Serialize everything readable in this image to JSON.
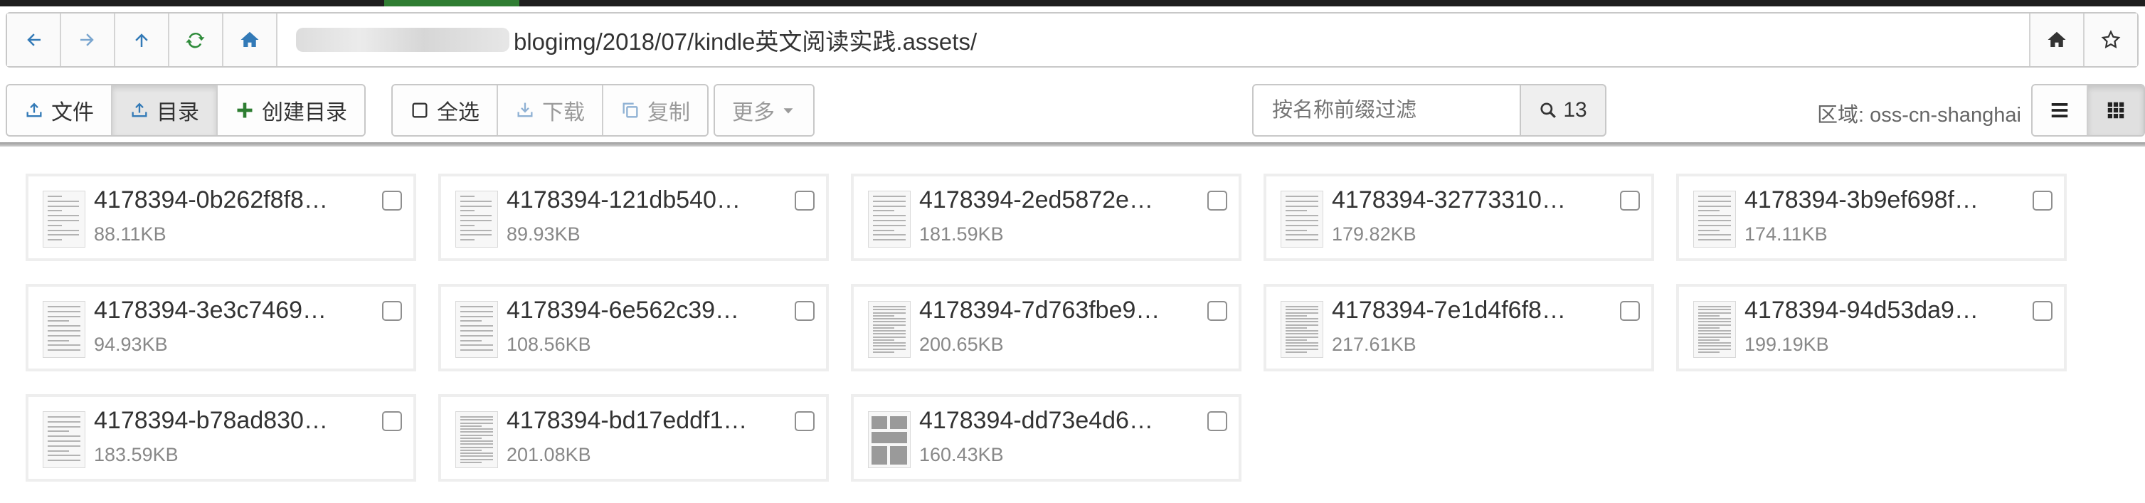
{
  "path": {
    "prefix_redacted": "oss://••••••••/",
    "text": "blogimg/2018/07/kindle英文阅读实践.assets/"
  },
  "nav_icons": [
    "arrow-left-icon",
    "arrow-right-icon",
    "arrow-up-icon",
    "refresh-icon",
    "home-icon"
  ],
  "nav_right_icons": [
    "home-icon",
    "star-icon"
  ],
  "toolbar": {
    "upload_file": "文件",
    "upload_dir": "目录",
    "create_dir": "创建目录",
    "select_all": "全选",
    "download": "下载",
    "copy": "复制",
    "more": "更多"
  },
  "filter": {
    "placeholder": "按名称前缀过滤",
    "count": "13"
  },
  "region_text": "区域: oss-cn-shanghai",
  "colors": {
    "accent_blue": "#337ab7",
    "accent_green": "#2e7d32",
    "disabled": "#9a9a9a"
  },
  "files": [
    {
      "name": "4178394-0b262f8f8…",
      "size": "88.11KB",
      "thumb": "ui"
    },
    {
      "name": "4178394-121db540…",
      "size": "89.93KB",
      "thumb": "ui"
    },
    {
      "name": "4178394-2ed5872e…",
      "size": "181.59KB",
      "thumb": "page"
    },
    {
      "name": "4178394-32773310…",
      "size": "179.82KB",
      "thumb": "page"
    },
    {
      "name": "4178394-3b9ef698f…",
      "size": "174.11KB",
      "thumb": "page"
    },
    {
      "name": "4178394-3e3c7469…",
      "size": "94.93KB",
      "thumb": "list"
    },
    {
      "name": "4178394-6e562c39…",
      "size": "108.56KB",
      "thumb": "list"
    },
    {
      "name": "4178394-7d763fbe9…",
      "size": "200.65KB",
      "thumb": "text"
    },
    {
      "name": "4178394-7e1d4f6f8…",
      "size": "217.61KB",
      "thumb": "text"
    },
    {
      "name": "4178394-94d53da9…",
      "size": "199.19KB",
      "thumb": "text"
    },
    {
      "name": "4178394-b78ad830…",
      "size": "183.59KB",
      "thumb": "page"
    },
    {
      "name": "4178394-bd17eddf1…",
      "size": "201.08KB",
      "thumb": "text"
    },
    {
      "name": "4178394-dd73e4d6…",
      "size": "160.43KB",
      "thumb": "photos"
    }
  ]
}
